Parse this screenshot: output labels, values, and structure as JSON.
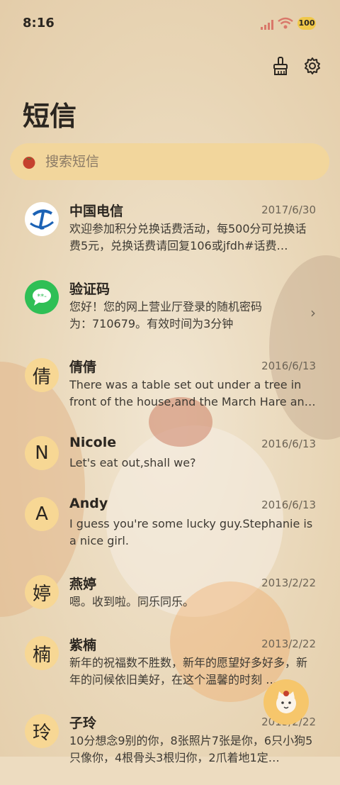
{
  "status": {
    "time": "8:16",
    "battery": "100"
  },
  "header": {
    "title": "短信"
  },
  "search": {
    "placeholder": "搜索短信"
  },
  "messages": [
    {
      "name": "中国电信",
      "date": "2017/6/30",
      "preview": "欢迎参加积分兑换话费活动，每500分可兑换话费5元，兑换话费请回复106或jfdh#话费…",
      "avatar_type": "telecom-logo"
    },
    {
      "name": "验证码",
      "date": "",
      "preview": "您好！您的网上营业厅登录的随机密码为：710679。有效时间为3分钟",
      "avatar_type": "sms-icon"
    },
    {
      "name": "倩倩",
      "date": "2016/6/13",
      "preview": "There was a table set out under a tree in front of the house,and the March Hare an…",
      "avatar_letter": "倩"
    },
    {
      "name": "Nicole",
      "date": "2016/6/13",
      "preview": "Let's eat out,shall we?",
      "avatar_letter": "N"
    },
    {
      "name": "Andy",
      "date": "2016/6/13",
      "preview": "I guess you're some lucky guy.Stephanie is a nice girl.",
      "avatar_letter": "A"
    },
    {
      "name": "燕婷",
      "date": "2013/2/22",
      "preview": "嗯。收到啦。同乐同乐。",
      "avatar_letter": "婷"
    },
    {
      "name": "紫楠",
      "date": "2013/2/22",
      "preview": "新年的祝福数不胜数，新年的愿望好多好多，新年的问候依旧美好，在这个温馨的时刻 …",
      "avatar_letter": "楠"
    },
    {
      "name": "子玲",
      "date": "2013/2/22",
      "preview": "10分想念9别的你，8张照片7张是你，6只小狗5只像你，4根骨头3根归你，2爪着地1定…",
      "avatar_letter": "玲"
    }
  ],
  "colors": {
    "accent": "#f2d69c",
    "avatar_bg": "#f7d794",
    "fab": "#f6c66b"
  }
}
